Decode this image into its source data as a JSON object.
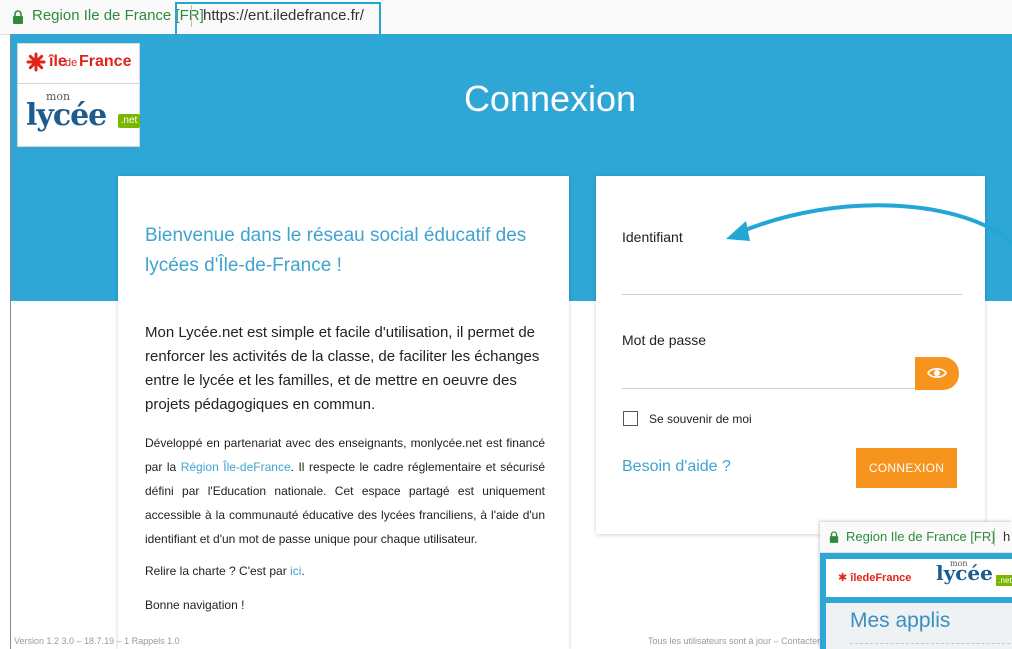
{
  "browser": {
    "site_name": "Region Ile de France [FR]",
    "url": "https://ent.iledefrance.fr/"
  },
  "logo": {
    "ile": "île",
    "de": "de",
    "france": "France",
    "mon": "mon",
    "lycee": "lycée",
    "net": ".net"
  },
  "page": {
    "title": "Connexion"
  },
  "welcome": {
    "title": "Bienvenue dans le réseau social éducatif des lycées d'Île-de-France !",
    "lead": "Mon Lycée.net est simple et facile d'utilisation, il permet de renforcer les activités de la classe, de faciliter les échanges entre le lycée et les familles, et de mettre en oeuvre des projets pédagogiques en commun.",
    "body_before": "Développé en partenariat avec des enseignants, monlycée.net est financé par la ",
    "body_link": "Région Île-deFrance",
    "body_after": ". Il respecte le cadre réglementaire et sécurisé défini par l'Education nationale. Cet espace partagé est uniquement accessible à la communauté éducative des lycées franciliens, à l'aide d'un identifiant et d'un mot de passe unique pour chaque utilisateur.",
    "charte_text": "Relire la charte ? C'est par ",
    "charte_link": "ici",
    "charte_end": ".",
    "goodbye": "Bonne navigation !"
  },
  "login": {
    "identifiant_label": "Identifiant",
    "identifiant_value": "",
    "password_label": "Mot de passe",
    "password_value": "",
    "remember_label": "Se souvenir de moi",
    "help_link": "Besoin d'aide ?",
    "connect_button": "CONNEXION"
  },
  "footer": {
    "left": "Version 1.2 3.0 – 18.7.19 – 1 Rappels 1.0",
    "right": "Tous les utilisateurs sont à jour – Contacter l'ENT"
  },
  "inset": {
    "site_name": "Region Ile de France [FR]",
    "url_fragment": "h",
    "idf": "✱ îledeFrance",
    "mon": "mon",
    "lycee": "lycée",
    "net": ".net",
    "title": "Mes applis"
  },
  "colors": {
    "brand_blue": "#2ea6d6",
    "accent_orange": "#f7941d",
    "link_blue": "#3fa3cf",
    "logo_red": "#e2231a",
    "annotation_blue": "#23a6d5"
  }
}
